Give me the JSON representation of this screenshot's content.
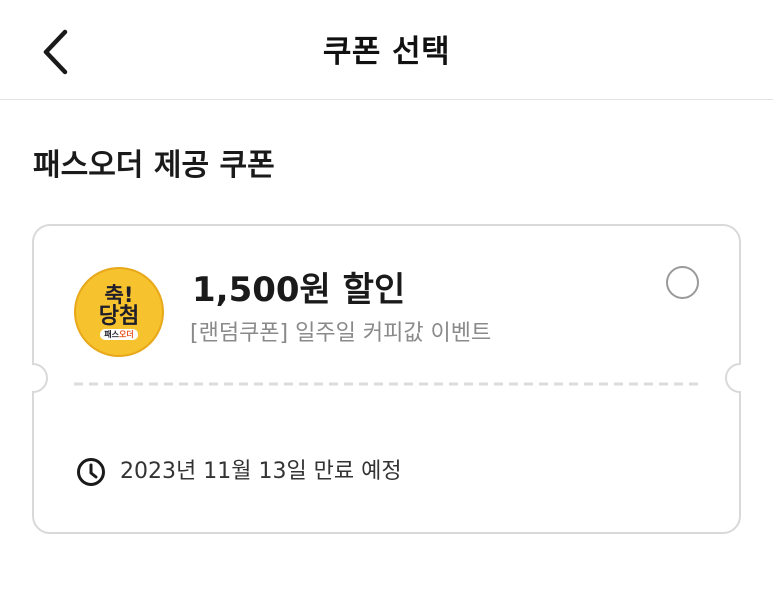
{
  "header": {
    "title": "쿠폰 선택",
    "back_icon": "chevron-left-icon"
  },
  "section": {
    "title": "패스오더 제공 쿠폰"
  },
  "coupons": [
    {
      "badge": {
        "line1": "축!",
        "line2": "당첨",
        "brand_part1": "패스",
        "brand_part2": "오더"
      },
      "discount": "1,500원 할인",
      "subtitle": "[랜덤쿠폰] 일주일 커피값 이벤트",
      "expiry": "2023년 11월 13일 만료 예정",
      "expiry_icon": "clock-icon",
      "selected": false
    }
  ],
  "colors": {
    "badge_bg": "#f6c22d",
    "badge_border": "#e8a81a",
    "brand_accent": "#e8551f",
    "card_border": "#d9d9d9",
    "divider": "#dcdcdc",
    "subtitle": "#8a8a8a"
  }
}
